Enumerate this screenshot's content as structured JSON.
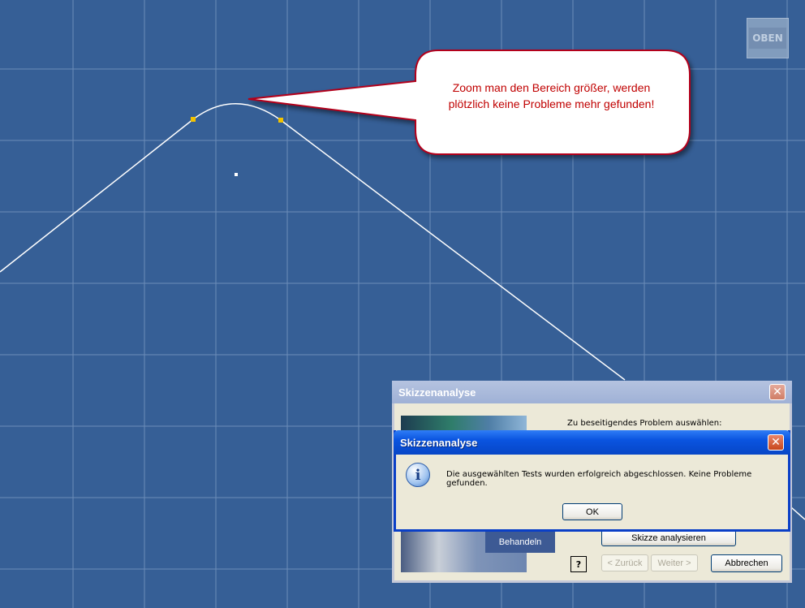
{
  "viewcube": {
    "label": "OBEN"
  },
  "callout": {
    "line1": "Zoom man den Bereich größer, werden",
    "line2": "plötzlich keine Probleme mehr gefunden!"
  },
  "background_dialog": {
    "title": "Skizzenanalyse",
    "prompt": "Zu beseitigendes Problem auswählen:",
    "behandeln_label": "Behandeln",
    "analyze_button": "Skizze analysieren",
    "help_label": "?",
    "back_button": "< Zurück",
    "next_button": "Weiter >",
    "cancel_button": "Abbrechen",
    "close_label": "✕"
  },
  "message_dialog": {
    "title": "Skizzenanalyse",
    "message": "Die ausgewählten Tests wurden erfolgreich abgeschlossen. Keine Probleme gefunden.",
    "ok_button": "OK",
    "icon": "info-icon",
    "icon_glyph": "i",
    "close_label": "✕"
  },
  "colors": {
    "canvas": "#365f96",
    "grid": "#7f9cc4",
    "callout_text": "#c00000",
    "constraint_point": "#f2c200"
  }
}
